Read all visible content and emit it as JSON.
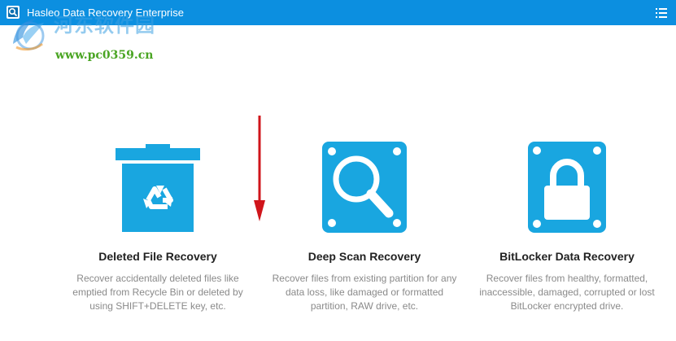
{
  "window": {
    "title": "Hasleo Data Recovery Enterprise",
    "icon": "app-icon",
    "menu_icon": "menu-list-icon"
  },
  "watermark": {
    "site_name_cn": "河东软件园",
    "url": "www.pc0359.cn"
  },
  "colors": {
    "titlebar": "#0c8fe0",
    "icon_blue": "#19a6e0",
    "arrow_red": "#d0151b",
    "title_text": "#222222",
    "desc_text": "#8a8a8a"
  },
  "options": [
    {
      "title": "Deleted File Recovery",
      "description": "Recover accidentally deleted files like emptied from Recycle Bin or deleted by using SHIFT+DELETE key, etc.",
      "icon": "recycle-bin-icon"
    },
    {
      "title": "Deep Scan Recovery",
      "description": "Recover files from existing partition for any data loss, like damaged or formatted partition, RAW drive, etc.",
      "icon": "magnifier-drive-icon"
    },
    {
      "title": "BitLocker Data Recovery",
      "description": "Recover files from healthy, formatted, inaccessible, damaged, corrupted or lost BitLocker encrypted drive.",
      "icon": "lock-drive-icon"
    }
  ]
}
